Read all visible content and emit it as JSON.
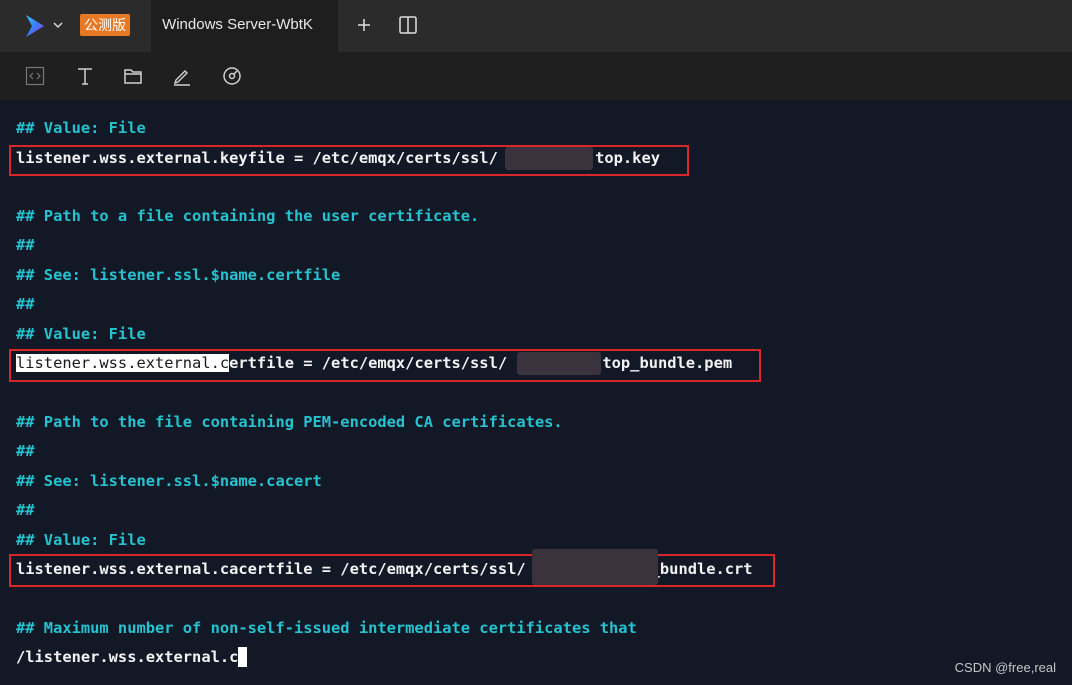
{
  "tabbar": {
    "badge": "公测版",
    "tab_title": "Windows Server-WbtK"
  },
  "toolbar": {
    "icons": [
      "code-icon",
      "text-icon",
      "folder-icon",
      "edit-icon",
      "dashboard-icon"
    ]
  },
  "terminal": {
    "lines": [
      {
        "kind": "comment",
        "text": "## Value: File"
      },
      {
        "kind": "cmd",
        "pre": "listener.wss.external.keyfile = /etc/emqx/certs/ssl/",
        "post": ".top.key"
      },
      {
        "kind": "comment",
        "text": "## Path to a file containing the user certificate."
      },
      {
        "kind": "comment",
        "text": "##"
      },
      {
        "kind": "comment",
        "text": "## See: listener.ssl.$name.certfile"
      },
      {
        "kind": "comment",
        "text": "##"
      },
      {
        "kind": "comment",
        "text": "## Value: File"
      },
      {
        "kind": "cmd",
        "sel": "listener.wss.external.c",
        "pre": "ertfile = /etc/emqx/certs/ssl/",
        "post": ".top_bundle.pem"
      },
      {
        "kind": "comment",
        "text": "## Path to the file containing PEM-encoded CA certificates."
      },
      {
        "kind": "comment",
        "text": "##"
      },
      {
        "kind": "comment",
        "text": "## See: listener.ssl.$name.cacert"
      },
      {
        "kind": "comment",
        "text": "##"
      },
      {
        "kind": "comment",
        "text": "## Value: File"
      },
      {
        "kind": "cmd",
        "pre": "listener.wss.external.cacertfile = /etc/emqx/certs/ssl/",
        "post": "_bundle.crt"
      },
      {
        "kind": "comment",
        "text": "## Maximum number of non-self-issued intermediate certificates that"
      },
      {
        "kind": "input",
        "text": "/listener.wss.external.c"
      }
    ]
  },
  "watermark": "CSDN @free,real"
}
